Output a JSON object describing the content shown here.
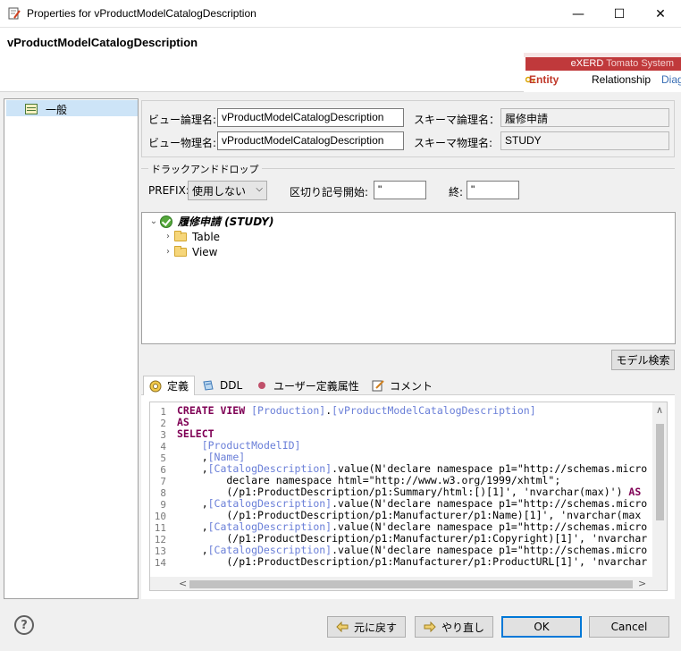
{
  "window": {
    "title": "Properties for vProductModelCatalogDescription",
    "minimize_glyph": "—",
    "maximize_glyph": "☐",
    "close_glyph": "✕"
  },
  "header": {
    "title": "vProductModelCatalogDescription",
    "banner": {
      "brand": "eXERD",
      "system": "Tomato System",
      "tabs": [
        "Entity",
        "Relationship",
        "Diag"
      ]
    }
  },
  "nav": {
    "items": [
      {
        "label": "一般",
        "icon": "table-icon"
      }
    ]
  },
  "props": {
    "view_logical_label": "ビュー論理名:",
    "view_logical_value": "vProductModelCatalogDescription",
    "schema_logical_label": "スキーマ論理名：",
    "schema_logical_value": "履修申請",
    "view_physical_label": "ビュー物理名:",
    "view_physical_value": "vProductModelCatalogDescription",
    "schema_physical_label": "スキーマ物理名:",
    "schema_physical_value": "STUDY"
  },
  "dnd": {
    "title": "ドラックアンドドロップ",
    "prefix_label": "PREFIX:",
    "prefix_value": "使用しない",
    "delim_start_label": "区切り記号開始:",
    "delim_start_value": "\"",
    "delim_end_label": "終:",
    "delim_end_value": "\""
  },
  "tree": {
    "root": "履修申請 (STUDY)",
    "children": [
      "Table",
      "View"
    ]
  },
  "model_search_button": "モデル検索",
  "tabs": [
    {
      "label": "定義",
      "icon": "definition-icon",
      "active": true
    },
    {
      "label": "DDL",
      "icon": "ddl-icon",
      "active": false
    },
    {
      "label": "ユーザー定義属性",
      "icon": "user-attribute-icon",
      "active": false
    },
    {
      "label": "コメント",
      "icon": "comment-icon",
      "active": false
    }
  ],
  "editor": {
    "line_numbers": [
      "1",
      "2",
      "3",
      "4",
      "5",
      "6",
      "7",
      "8",
      "9",
      "10",
      "11",
      "12",
      "13",
      "14"
    ],
    "lines": [
      "CREATE VIEW [Production].[vProductModelCatalogDescription]",
      "AS",
      "SELECT",
      "    [ProductModelID]",
      "    ,[Name]",
      "    ,[CatalogDescription].value(N'declare namespace p1=\"http://schemas.micro",
      "        declare namespace html=\"http://www.w3.org/1999/xhtml\";",
      "        (/p1:ProductDescription/p1:Summary/html:[)[1]', 'nvarchar(max)') AS",
      "    ,[CatalogDescription].value(N'declare namespace p1=\"http://schemas.micro",
      "        (/p1:ProductDescription/p1:Manufacturer/p1:Name)[1]', 'nvarchar(max",
      "    ,[CatalogDescription].value(N'declare namespace p1=\"http://schemas.micro",
      "        (/p1:ProductDescription/p1:Manufacturer/p1:Copyright)[1]', 'nvarchar",
      "    ,[CatalogDescription].value(N'declare namespace p1=\"http://schemas.micro",
      "        (/p1:ProductDescription/p1:Manufacturer/p1:ProductURL[1]', 'nvarchar"
    ]
  },
  "footer": {
    "help": "?",
    "revert": "元に戻す",
    "redo": "やり直し",
    "ok": "OK",
    "cancel": "Cancel"
  },
  "colors": {
    "accent": "#0078d7",
    "banner_red": "#c0393b",
    "keyword": "#7f0055",
    "identifier": "#6a7fd8"
  }
}
